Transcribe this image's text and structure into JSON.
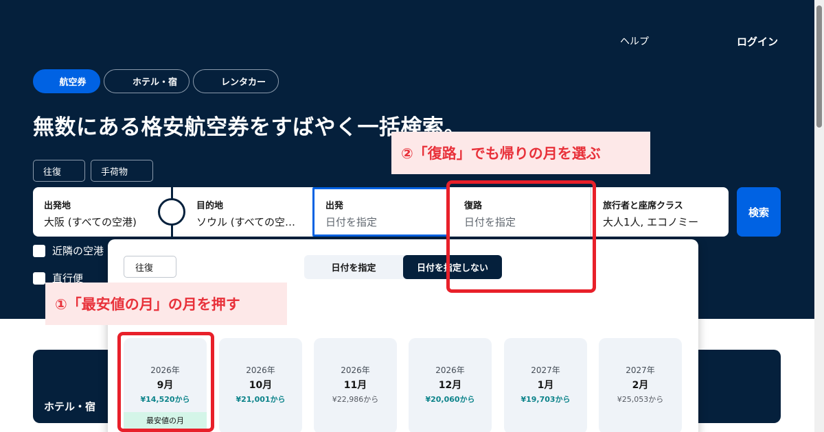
{
  "header": {
    "help": "ヘルプ",
    "login": "ログイン"
  },
  "category_tabs": [
    {
      "label": "航空券",
      "active": true
    },
    {
      "label": "ホテル・宿",
      "active": false
    },
    {
      "label": "レンタカー",
      "active": false
    }
  ],
  "headline": "無数にある格安航空券をすばやく一括検索。",
  "options": {
    "trip_type": "往復",
    "baggage": "手荷物"
  },
  "search": {
    "origin_label": "出発地",
    "origin_value": "大阪 (すべての空港)",
    "destination_label": "目的地",
    "destination_value": "ソウル (すべての空…",
    "depart_label": "出発",
    "depart_placeholder": "日付を指定",
    "return_label": "復路",
    "return_placeholder": "日付を指定",
    "travelers_label": "旅行者と座席クラス",
    "travelers_value": "大人1人, エコノミー",
    "search_button": "検索"
  },
  "checkboxes": {
    "nearby": "近隣の空港",
    "direct": "直行便"
  },
  "hotel_card": {
    "title": "ホテル・宿"
  },
  "date_popup": {
    "trip_select": "往復",
    "segments": [
      {
        "label": "日付を指定",
        "selected": false
      },
      {
        "label": "日付を指定しない",
        "selected": true
      }
    ],
    "months": [
      {
        "year": "2026年",
        "month": "9月",
        "price": "¥14,520から",
        "highlight": true,
        "badge": "最安値の月"
      },
      {
        "year": "2026年",
        "month": "10月",
        "price": "¥21,001から",
        "highlight": true
      },
      {
        "year": "2026年",
        "month": "11月",
        "price": "¥22,986から",
        "highlight": false
      },
      {
        "year": "2026年",
        "month": "12月",
        "price": "¥20,060から",
        "highlight": true
      },
      {
        "year": "2027年",
        "month": "1月",
        "price": "¥19,703から",
        "highlight": true
      },
      {
        "year": "2027年",
        "month": "2月",
        "price": "¥25,053から",
        "highlight": false
      }
    ]
  },
  "annotations": {
    "step1": "①「最安値の月」の月を押す",
    "step2": "②「復路」でも帰りの月を選ぶ"
  },
  "colors": {
    "navy": "#05203c",
    "blue": "#0062e3",
    "price_teal": "#0c838a",
    "badge_green": "#d4f5e8",
    "annotation_red": "#e8313a",
    "annotation_bg": "#fde8e8"
  }
}
